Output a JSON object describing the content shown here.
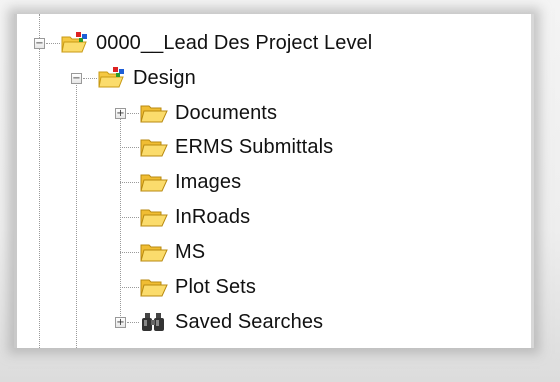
{
  "tree": {
    "root": {
      "label": "0000__Lead Des Project Level",
      "icon": "project-folder-icon",
      "expanded": true
    },
    "design": {
      "label": "Design",
      "icon": "project-folder-icon",
      "expanded": true
    },
    "children": [
      {
        "label": "Documents",
        "icon": "folder-icon",
        "expandable": true
      },
      {
        "label": "ERMS Submittals",
        "icon": "folder-icon",
        "expandable": false
      },
      {
        "label": "Images",
        "icon": "folder-icon",
        "expandable": false
      },
      {
        "label": "InRoads",
        "icon": "folder-icon",
        "expandable": false
      },
      {
        "label": "MS",
        "icon": "folder-icon",
        "expandable": false
      },
      {
        "label": "Plot Sets",
        "icon": "folder-icon",
        "expandable": false
      },
      {
        "label": "Saved Searches",
        "icon": "binoculars-icon",
        "expandable": true
      }
    ]
  },
  "colors": {
    "folder": "#f5c842",
    "folder_dark": "#c89a14",
    "accent_red": "#d22",
    "accent_blue": "#1e5fd8",
    "accent_green": "#2a9a2a"
  }
}
